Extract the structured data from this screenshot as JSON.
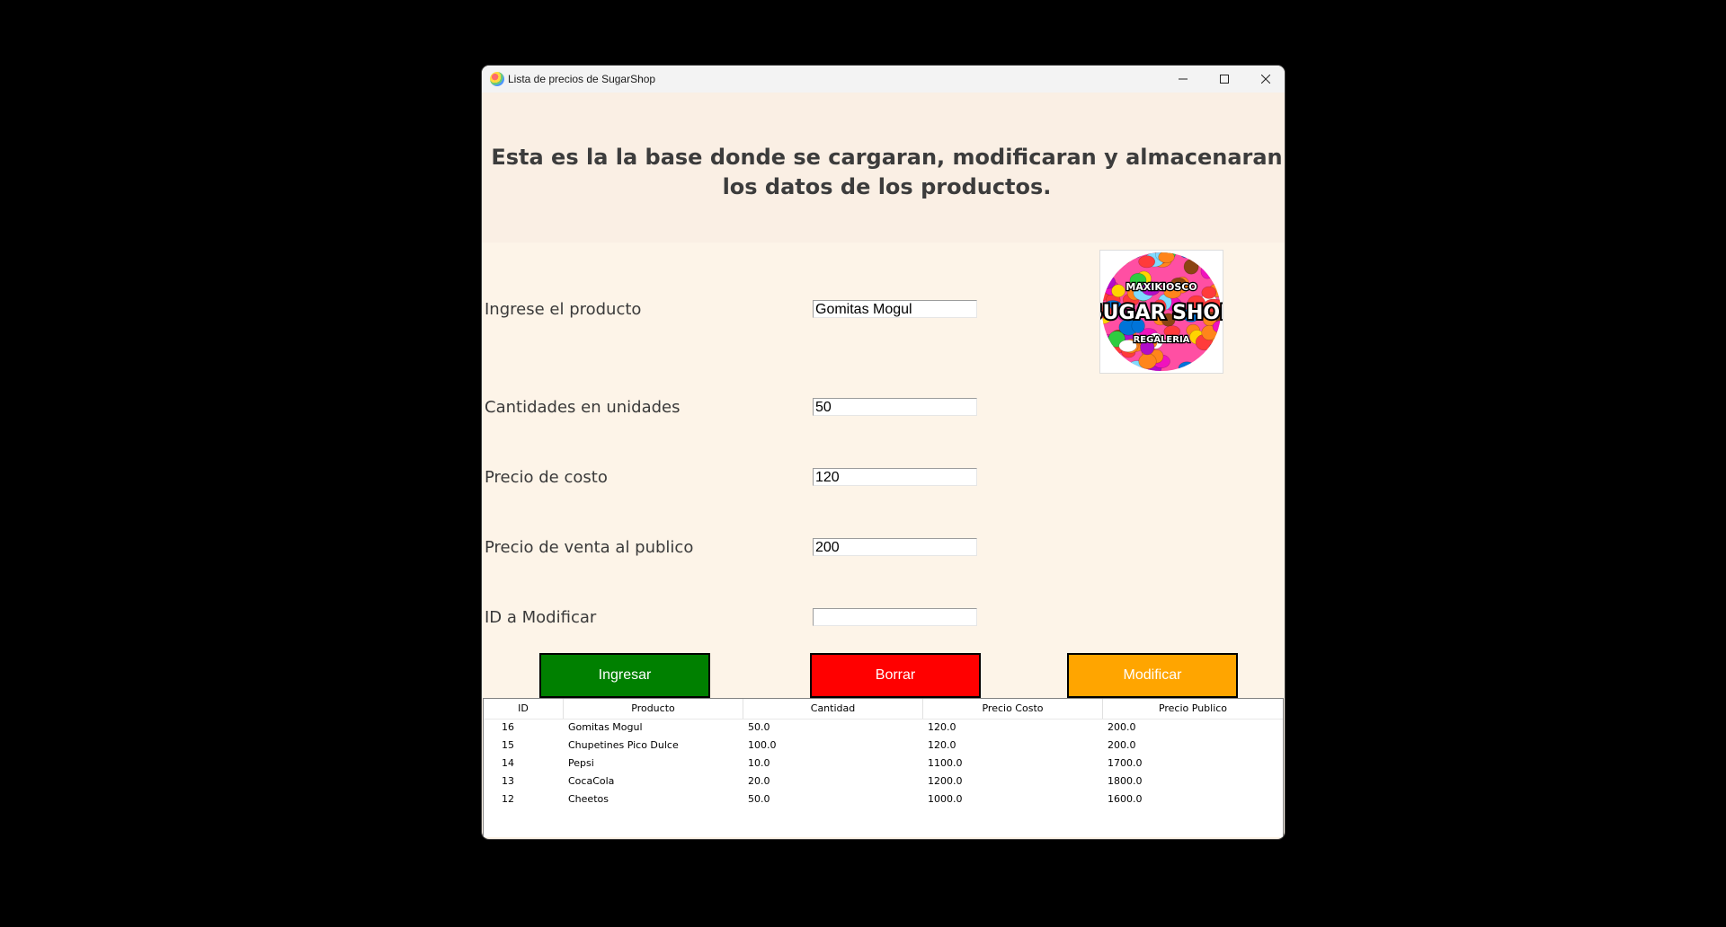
{
  "window": {
    "title": "Lista de precios de SugarShop"
  },
  "header": {
    "headline": "Esta es la la base donde se cargaran, modificaran y almacenaran los datos de los productos."
  },
  "form": {
    "producto_label": "Ingrese el producto",
    "producto_value": "Gomitas Mogul",
    "cantidad_label": "Cantidades en unidades",
    "cantidad_value": "50",
    "costo_label": "Precio de costo",
    "costo_value": "120",
    "venta_label": "Precio de venta al publico",
    "venta_value": "200",
    "id_label": "ID a Modificar",
    "id_value": ""
  },
  "logo": {
    "top_text": "MAXIKIOSCO",
    "main_text": "SUGAR SHOP",
    "bottom_text": "REGALERIA"
  },
  "buttons": {
    "ingresar": "Ingresar",
    "borrar": "Borrar",
    "modificar": "Modificar"
  },
  "colors": {
    "ingresar": "#008000",
    "borrar": "#ff0000",
    "modificar": "#ffa500",
    "background": "#fdf4e8"
  },
  "table": {
    "columns": [
      "ID",
      "Producto",
      "Cantidad",
      "Precio Costo",
      "Precio Publico"
    ],
    "rows": [
      [
        "16",
        "Gomitas Mogul",
        "50.0",
        "120.0",
        "200.0"
      ],
      [
        "15",
        "Chupetines Pico Dulce",
        "100.0",
        "120.0",
        "200.0"
      ],
      [
        "14",
        "Pepsi",
        "10.0",
        "1100.0",
        "1700.0"
      ],
      [
        "13",
        "CocaCola",
        "20.0",
        "1200.0",
        "1800.0"
      ],
      [
        "12",
        "Cheetos",
        "50.0",
        "1000.0",
        "1600.0"
      ]
    ]
  }
}
